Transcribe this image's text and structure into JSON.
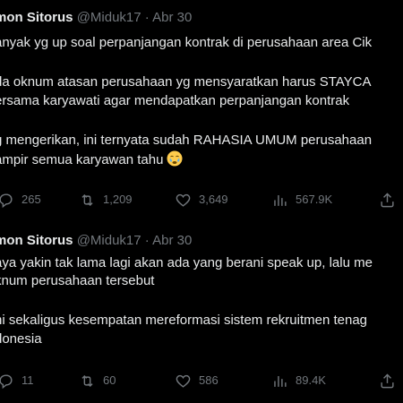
{
  "tweets": [
    {
      "author": "mon Sitorus",
      "handle": "@Miduk17",
      "separator": "·",
      "date": "Abr 30",
      "lines": [
        "anyak yg up soal perpanjangan kontrak di perusahaan area Cik",
        "",
        "da oknum atasan perusahaan yg mensyaratkan harus STAYCA",
        "ersama karyawati agar mendapatkan perpanjangan kontrak",
        "",
        "g mengerikan, ini ternyata sudah RAHASIA UMUM perusahaan",
        "ampir semua karyawan tahu"
      ],
      "emoji": "crying-face",
      "actions": {
        "replies": "265",
        "reposts": "1,209",
        "likes": "3,649",
        "views": "567.9K"
      }
    },
    {
      "author": "mon Sitorus",
      "handle": "@Miduk17",
      "separator": "·",
      "date": "Abr 30",
      "lines": [
        "aya yakin tak lama lagi akan ada yang berani speak up, lalu me",
        "knum perusahaan tersebut",
        "",
        "ni sekaligus kesempatan mereformasi sistem rekruitmen tenag",
        "donesia"
      ],
      "actions": {
        "replies": "11",
        "reposts": "60",
        "likes": "586",
        "views": "89.4K"
      }
    }
  ],
  "colors": {
    "background": "#000000",
    "text": "#e7e9ea",
    "muted": "#71767b"
  }
}
